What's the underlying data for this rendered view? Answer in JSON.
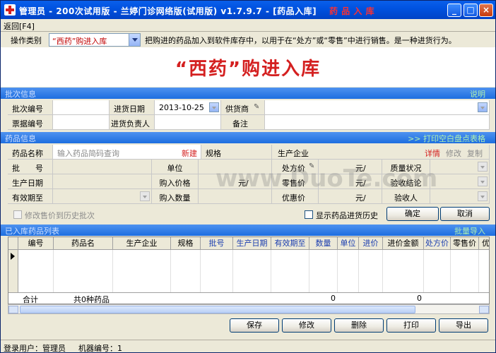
{
  "window": {
    "title_left": "管理员 - 200次试用版 - 兰婷门诊网络版(试用版) v1.7.9.7 - [药品入库]",
    "title_right": "药 品 入 库",
    "btn_min": "_",
    "btn_max": "□",
    "btn_close": "×"
  },
  "menu": {
    "back": "返回[F4]"
  },
  "operation": {
    "label": "操作类别",
    "value": "“西药”购进入库",
    "description": "把购进的药品加入到软件库存中，以用于在“处方”或“零售”中进行销售。是一种进货行为。"
  },
  "heading": "“西药”购进入库",
  "batch_section": {
    "title": "批次信息",
    "link": "说明",
    "batch_no_label": "批次编号",
    "date_label": "进货日期",
    "date_value": "2013-10-25",
    "supplier_label": "供货商",
    "invoice_label": "票据编号",
    "buyer_label": "进货负责人",
    "remark_label": "备注"
  },
  "drug_section": {
    "title": "药品信息",
    "link": ">>  打印空白盘点表格",
    "name_label": "药品名称",
    "name_placeholder": "输入药品简码查询",
    "new_link": "新建",
    "spec_label": "规格",
    "maker_label": "生产企业",
    "details_link": "详情",
    "edit_link": "修改",
    "copy_link": "复制",
    "batch_label": "批　　号",
    "unit_label": "单位",
    "rx_price_label": "处方价",
    "rx_price_unit": "元/",
    "quality_label": "质量状况",
    "prod_date_label": "生产日期",
    "buy_price_label": "购入价格",
    "buy_price_unit": "元/",
    "retail_label": "零售价",
    "retail_unit": "元/",
    "accept_label": "验收结论",
    "expiry_label": "有效期至",
    "qty_label": "购入数量",
    "discount_label": "优惠价",
    "discount_unit": "元/",
    "receiver_label": "验收人",
    "modify_history": "修改售价到历史批次",
    "show_history": "显示药品进货历史",
    "confirm": "确定",
    "cancel": "取消"
  },
  "list_section": {
    "title": "已入库药品列表",
    "link": "批量导入",
    "columns": [
      "编号",
      "药品名",
      "生产企业",
      "规格",
      "批号",
      "生产日期",
      "有效期至",
      "数量",
      "单位",
      "进价",
      "进价金额",
      "处方价",
      "零售价",
      "优"
    ],
    "footer_label": "合计",
    "footer_count": "共0种药品",
    "footer_qty": "0",
    "footer_amount": "0"
  },
  "actions": {
    "save": "保存",
    "modify": "修改",
    "delete": "删除",
    "print": "打印",
    "export": "导出"
  },
  "status": {
    "user": "登录用户：管理员",
    "machine": "机器编号：1"
  },
  "watermark": "www.DuoTe.com",
  "colors": {
    "heading": "#D42020",
    "section_header": "#1D6EE0",
    "titlebar": "#0053E1"
  }
}
